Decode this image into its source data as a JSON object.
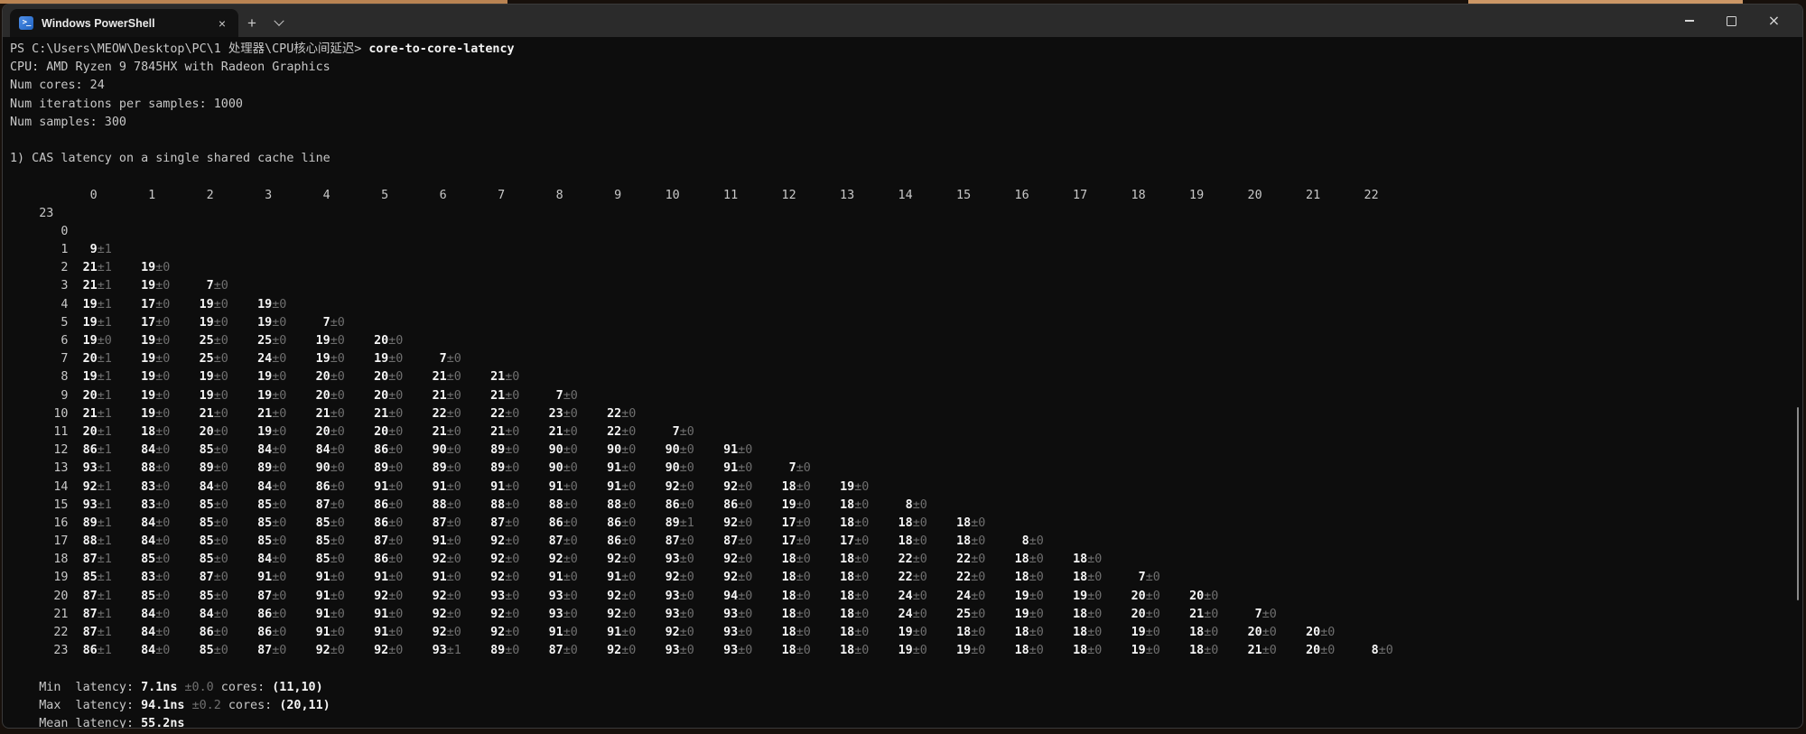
{
  "window": {
    "tab_title": "Windows PowerShell",
    "icons": {
      "powershell": "powershell-logo",
      "tab_close": "×",
      "new_tab": "+",
      "dropdown": "chevron-down",
      "minimize": "minimize-bar",
      "maximize": "maximize-square",
      "window_close": "×"
    }
  },
  "terminal": {
    "prompt": "PS C:\\Users\\MEOW\\Desktop\\PC\\1 处理器\\CPU核心间延迟>",
    "command": "core-to-core-latency",
    "info_lines": [
      "CPU: AMD Ryzen 9 7845HX with Radeon Graphics",
      "Num cores: 24",
      "Num iterations per samples: 1000",
      "Num samples: 300"
    ],
    "section_title": "1) CAS latency on a single shared cache line",
    "table": {
      "col_headers": [
        "0",
        "1",
        "2",
        "3",
        "4",
        "5",
        "6",
        "7",
        "8",
        "9",
        "10",
        "11",
        "12",
        "13",
        "14",
        "15",
        "16",
        "17",
        "18",
        "19",
        "20",
        "21",
        "22",
        "23"
      ],
      "row_labels": [
        "0",
        "1",
        "2",
        "3",
        "4",
        "5",
        "6",
        "7",
        "8",
        "9",
        "10",
        "11",
        "12",
        "13",
        "14",
        "15",
        "16",
        "17",
        "18",
        "19",
        "20",
        "21",
        "22",
        "23"
      ],
      "cells": [
        [],
        [
          [
            9,
            1
          ]
        ],
        [
          [
            21,
            1
          ],
          [
            19,
            0
          ]
        ],
        [
          [
            21,
            1
          ],
          [
            19,
            0
          ],
          [
            7,
            0
          ]
        ],
        [
          [
            19,
            1
          ],
          [
            17,
            0
          ],
          [
            19,
            0
          ],
          [
            19,
            0
          ]
        ],
        [
          [
            19,
            1
          ],
          [
            17,
            0
          ],
          [
            19,
            0
          ],
          [
            19,
            0
          ],
          [
            7,
            0
          ]
        ],
        [
          [
            19,
            0
          ],
          [
            19,
            0
          ],
          [
            25,
            0
          ],
          [
            25,
            0
          ],
          [
            19,
            0
          ],
          [
            20,
            0
          ]
        ],
        [
          [
            20,
            1
          ],
          [
            19,
            0
          ],
          [
            25,
            0
          ],
          [
            24,
            0
          ],
          [
            19,
            0
          ],
          [
            19,
            0
          ],
          [
            7,
            0
          ]
        ],
        [
          [
            19,
            1
          ],
          [
            19,
            0
          ],
          [
            19,
            0
          ],
          [
            19,
            0
          ],
          [
            20,
            0
          ],
          [
            20,
            0
          ],
          [
            21,
            0
          ],
          [
            21,
            0
          ]
        ],
        [
          [
            20,
            1
          ],
          [
            19,
            0
          ],
          [
            19,
            0
          ],
          [
            19,
            0
          ],
          [
            20,
            0
          ],
          [
            20,
            0
          ],
          [
            21,
            0
          ],
          [
            21,
            0
          ],
          [
            7,
            0
          ]
        ],
        [
          [
            21,
            1
          ],
          [
            19,
            0
          ],
          [
            21,
            0
          ],
          [
            21,
            0
          ],
          [
            21,
            0
          ],
          [
            21,
            0
          ],
          [
            22,
            0
          ],
          [
            22,
            0
          ],
          [
            23,
            0
          ],
          [
            22,
            0
          ]
        ],
        [
          [
            20,
            1
          ],
          [
            18,
            0
          ],
          [
            20,
            0
          ],
          [
            19,
            0
          ],
          [
            20,
            0
          ],
          [
            20,
            0
          ],
          [
            21,
            0
          ],
          [
            21,
            0
          ],
          [
            21,
            0
          ],
          [
            22,
            0
          ],
          [
            7,
            0
          ]
        ],
        [
          [
            86,
            1
          ],
          [
            84,
            0
          ],
          [
            85,
            0
          ],
          [
            84,
            0
          ],
          [
            84,
            0
          ],
          [
            86,
            0
          ],
          [
            90,
            0
          ],
          [
            89,
            0
          ],
          [
            90,
            0
          ],
          [
            90,
            0
          ],
          [
            90,
            0
          ],
          [
            91,
            0
          ]
        ],
        [
          [
            93,
            1
          ],
          [
            88,
            0
          ],
          [
            89,
            0
          ],
          [
            89,
            0
          ],
          [
            90,
            0
          ],
          [
            89,
            0
          ],
          [
            89,
            0
          ],
          [
            89,
            0
          ],
          [
            90,
            0
          ],
          [
            91,
            0
          ],
          [
            90,
            0
          ],
          [
            91,
            0
          ],
          [
            7,
            0
          ]
        ],
        [
          [
            92,
            1
          ],
          [
            83,
            0
          ],
          [
            84,
            0
          ],
          [
            84,
            0
          ],
          [
            86,
            0
          ],
          [
            91,
            0
          ],
          [
            91,
            0
          ],
          [
            91,
            0
          ],
          [
            91,
            0
          ],
          [
            91,
            0
          ],
          [
            92,
            0
          ],
          [
            92,
            0
          ],
          [
            18,
            0
          ],
          [
            19,
            0
          ]
        ],
        [
          [
            93,
            1
          ],
          [
            83,
            0
          ],
          [
            85,
            0
          ],
          [
            85,
            0
          ],
          [
            87,
            0
          ],
          [
            86,
            0
          ],
          [
            88,
            0
          ],
          [
            88,
            0
          ],
          [
            88,
            0
          ],
          [
            88,
            0
          ],
          [
            86,
            0
          ],
          [
            86,
            0
          ],
          [
            19,
            0
          ],
          [
            18,
            0
          ],
          [
            8,
            0
          ]
        ],
        [
          [
            89,
            1
          ],
          [
            84,
            0
          ],
          [
            85,
            0
          ],
          [
            85,
            0
          ],
          [
            85,
            0
          ],
          [
            86,
            0
          ],
          [
            87,
            0
          ],
          [
            87,
            0
          ],
          [
            86,
            0
          ],
          [
            86,
            0
          ],
          [
            89,
            1
          ],
          [
            92,
            0
          ],
          [
            17,
            0
          ],
          [
            18,
            0
          ],
          [
            18,
            0
          ],
          [
            18,
            0
          ]
        ],
        [
          [
            88,
            1
          ],
          [
            84,
            0
          ],
          [
            85,
            0
          ],
          [
            85,
            0
          ],
          [
            85,
            0
          ],
          [
            87,
            0
          ],
          [
            91,
            0
          ],
          [
            92,
            0
          ],
          [
            87,
            0
          ],
          [
            86,
            0
          ],
          [
            87,
            0
          ],
          [
            87,
            0
          ],
          [
            17,
            0
          ],
          [
            17,
            0
          ],
          [
            18,
            0
          ],
          [
            18,
            0
          ],
          [
            8,
            0
          ]
        ],
        [
          [
            87,
            1
          ],
          [
            85,
            0
          ],
          [
            85,
            0
          ],
          [
            84,
            0
          ],
          [
            85,
            0
          ],
          [
            86,
            0
          ],
          [
            92,
            0
          ],
          [
            92,
            0
          ],
          [
            92,
            0
          ],
          [
            92,
            0
          ],
          [
            93,
            0
          ],
          [
            92,
            0
          ],
          [
            18,
            0
          ],
          [
            18,
            0
          ],
          [
            22,
            0
          ],
          [
            22,
            0
          ],
          [
            18,
            0
          ],
          [
            18,
            0
          ]
        ],
        [
          [
            85,
            1
          ],
          [
            83,
            0
          ],
          [
            87,
            0
          ],
          [
            91,
            0
          ],
          [
            91,
            0
          ],
          [
            91,
            0
          ],
          [
            91,
            0
          ],
          [
            92,
            0
          ],
          [
            91,
            0
          ],
          [
            91,
            0
          ],
          [
            92,
            0
          ],
          [
            92,
            0
          ],
          [
            18,
            0
          ],
          [
            18,
            0
          ],
          [
            22,
            0
          ],
          [
            22,
            0
          ],
          [
            18,
            0
          ],
          [
            18,
            0
          ],
          [
            7,
            0
          ]
        ],
        [
          [
            87,
            1
          ],
          [
            85,
            0
          ],
          [
            85,
            0
          ],
          [
            87,
            0
          ],
          [
            91,
            0
          ],
          [
            92,
            0
          ],
          [
            92,
            0
          ],
          [
            93,
            0
          ],
          [
            93,
            0
          ],
          [
            92,
            0
          ],
          [
            93,
            0
          ],
          [
            94,
            0
          ],
          [
            18,
            0
          ],
          [
            18,
            0
          ],
          [
            24,
            0
          ],
          [
            24,
            0
          ],
          [
            19,
            0
          ],
          [
            19,
            0
          ],
          [
            20,
            0
          ],
          [
            20,
            0
          ]
        ],
        [
          [
            87,
            1
          ],
          [
            84,
            0
          ],
          [
            84,
            0
          ],
          [
            86,
            0
          ],
          [
            91,
            0
          ],
          [
            91,
            0
          ],
          [
            92,
            0
          ],
          [
            92,
            0
          ],
          [
            93,
            0
          ],
          [
            92,
            0
          ],
          [
            93,
            0
          ],
          [
            93,
            0
          ],
          [
            18,
            0
          ],
          [
            18,
            0
          ],
          [
            24,
            0
          ],
          [
            25,
            0
          ],
          [
            19,
            0
          ],
          [
            18,
            0
          ],
          [
            20,
            0
          ],
          [
            21,
            0
          ],
          [
            7,
            0
          ]
        ],
        [
          [
            87,
            1
          ],
          [
            84,
            0
          ],
          [
            86,
            0
          ],
          [
            86,
            0
          ],
          [
            91,
            0
          ],
          [
            91,
            0
          ],
          [
            92,
            0
          ],
          [
            92,
            0
          ],
          [
            91,
            0
          ],
          [
            91,
            0
          ],
          [
            92,
            0
          ],
          [
            93,
            0
          ],
          [
            18,
            0
          ],
          [
            18,
            0
          ],
          [
            19,
            0
          ],
          [
            18,
            0
          ],
          [
            18,
            0
          ],
          [
            18,
            0
          ],
          [
            19,
            0
          ],
          [
            18,
            0
          ],
          [
            20,
            0
          ],
          [
            20,
            0
          ]
        ],
        [
          [
            86,
            1
          ],
          [
            84,
            0
          ],
          [
            85,
            0
          ],
          [
            87,
            0
          ],
          [
            92,
            0
          ],
          [
            92,
            0
          ],
          [
            93,
            1
          ],
          [
            89,
            0
          ],
          [
            87,
            0
          ],
          [
            92,
            0
          ],
          [
            93,
            0
          ],
          [
            93,
            0
          ],
          [
            18,
            0
          ],
          [
            18,
            0
          ],
          [
            19,
            0
          ],
          [
            19,
            0
          ],
          [
            18,
            0
          ],
          [
            18,
            0
          ],
          [
            19,
            0
          ],
          [
            18,
            0
          ],
          [
            21,
            0
          ],
          [
            20,
            0
          ],
          [
            8,
            0
          ]
        ]
      ]
    },
    "footer": {
      "min": {
        "label": "Min  latency:",
        "value": "7.1ns",
        "error": "±0.0",
        "cores_label": "cores:",
        "cores": "(11,10)"
      },
      "max": {
        "label": "Max  latency:",
        "value": "94.1ns",
        "error": "±0.2",
        "cores_label": "cores:",
        "cores": "(20,11)"
      },
      "mean": {
        "label": "Mean latency:",
        "value": "55.2ns"
      }
    }
  },
  "colors": {
    "terminal_bg": "#0d0d0d",
    "titlebar_bg": "#2b2b2b",
    "foreground": "#c8c8c8",
    "bold_white": "#f5f5f5",
    "dim": "#6f6f6f",
    "powershell_blue": "#2f7cd6",
    "desktop_strip": "#c08a58",
    "scrollbar_thumb": "#8a8a8a"
  }
}
